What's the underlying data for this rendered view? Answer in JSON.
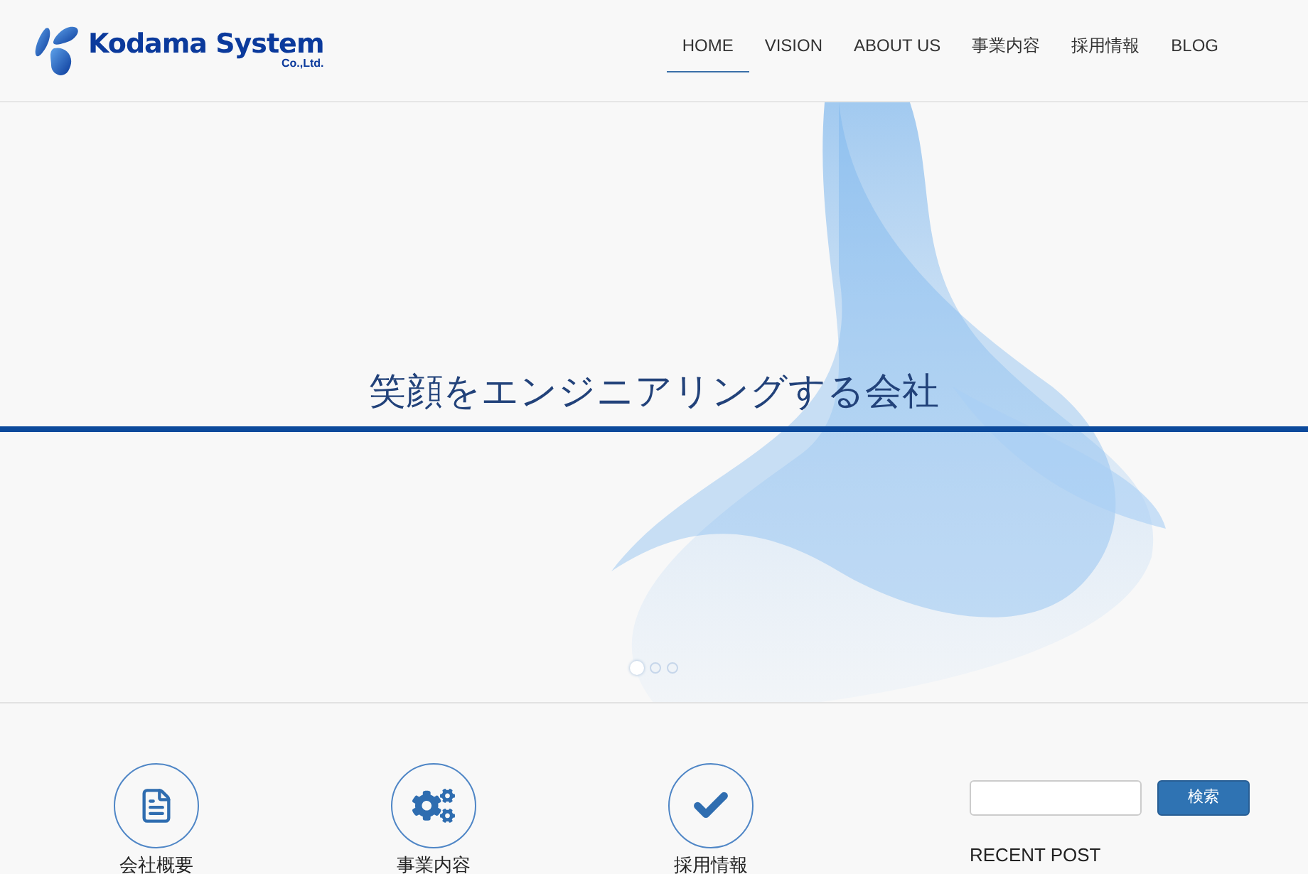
{
  "logo": {
    "name": "Kodama System",
    "suffix": "Co.,Ltd."
  },
  "nav": [
    {
      "label": "HOME",
      "selected": true
    },
    {
      "label": "VISION",
      "selected": false
    },
    {
      "label": "ABOUT US",
      "selected": false
    },
    {
      "label": "事業内容",
      "selected": false
    },
    {
      "label": "採用情報",
      "selected": false
    },
    {
      "label": "BLOG",
      "selected": false
    }
  ],
  "hero": {
    "headline": "笑顔をエンジニアリングする会社",
    "slides": [
      {
        "selected": true
      },
      {
        "selected": false
      },
      {
        "selected": false
      }
    ]
  },
  "features": [
    {
      "kind": "document",
      "label": "会社概要"
    },
    {
      "kind": "gears",
      "label": "事業内容"
    },
    {
      "kind": "check",
      "label": "採用情報"
    }
  ],
  "sidebar": {
    "search_button": "検索",
    "recent_heading": "RECENT POST"
  }
}
